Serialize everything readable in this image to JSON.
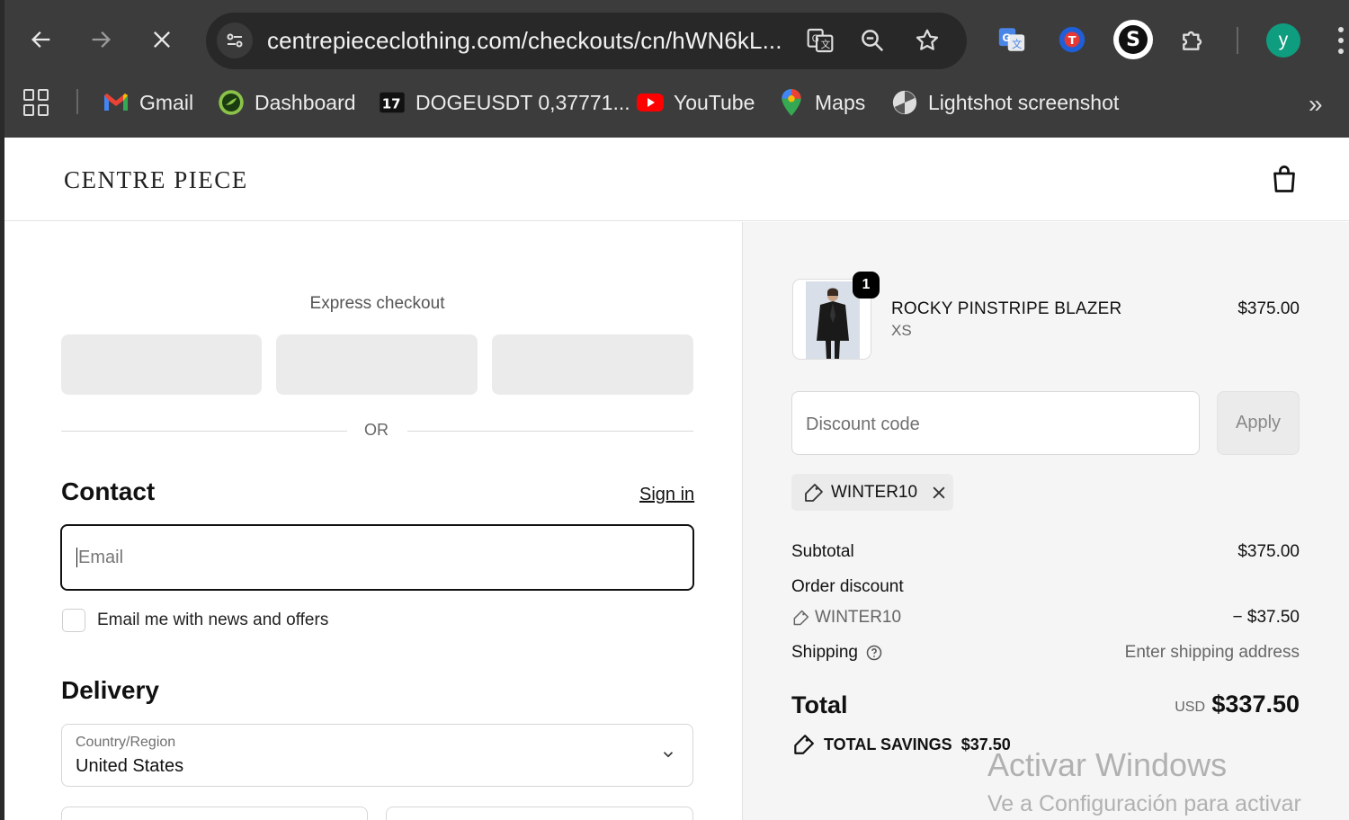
{
  "browser": {
    "url": "centrepiececlothing.com/checkouts/cn/hWN6kL...",
    "profile_initial": "y",
    "extensions": [
      "translate-icon",
      "vpn-extension-icon",
      "s-extension-icon",
      "puzzle-icon"
    ],
    "bookmarks": [
      {
        "label": "Gmail",
        "icon": "gmail-icon"
      },
      {
        "label": "Dashboard",
        "icon": "dashboard-icon"
      },
      {
        "label": "DOGEUSDT 0,37771...",
        "icon": "tradingview-icon"
      },
      {
        "label": "YouTube",
        "icon": "youtube-icon"
      },
      {
        "label": "Maps",
        "icon": "maps-icon"
      },
      {
        "label": "Lightshot screenshot",
        "icon": "lightshot-icon"
      }
    ],
    "more_label": "»"
  },
  "store": {
    "logo": "CENTRE PIECE"
  },
  "checkout": {
    "express_title": "Express checkout",
    "or_label": "OR",
    "contact_heading": "Contact",
    "sign_in": "Sign in",
    "email_placeholder": "Email",
    "newsletter_label": "Email me with news and offers",
    "delivery_heading": "Delivery",
    "country_label": "Country/Region",
    "country_value": "United States"
  },
  "summary": {
    "item": {
      "name": "ROCKY PINSTRIPE BLAZER",
      "variant": "XS",
      "price": "$375.00",
      "quantity": "1"
    },
    "discount_placeholder": "Discount code",
    "apply_label": "Apply",
    "applied_code": "WINTER10",
    "subtotal_label": "Subtotal",
    "subtotal_value": "$375.00",
    "order_discount_label": "Order discount",
    "discount_code": "WINTER10",
    "discount_value": "− $37.50",
    "shipping_label": "Shipping",
    "shipping_value": "Enter shipping address",
    "total_label": "Total",
    "total_currency": "USD",
    "total_value": "$337.50",
    "savings_label": "TOTAL SAVINGS",
    "savings_value": "$37.50"
  },
  "watermark": {
    "line1": "Activar Windows",
    "line2": "Ve a Configuración para activar"
  }
}
